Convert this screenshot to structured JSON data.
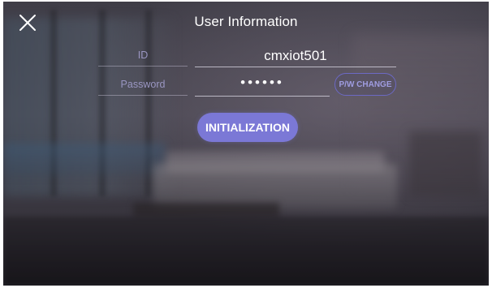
{
  "header": {
    "title": "User Information",
    "close_icon": "close-icon"
  },
  "form": {
    "id_label": "ID",
    "id_value": "cmxiot501",
    "password_label": "Password",
    "password_value": "••••••",
    "pw_change_label": "P/W CHANGE"
  },
  "actions": {
    "initialization_label": "INITIALIZATION"
  },
  "colors": {
    "accent": "#7b78d6",
    "label": "#9a96c2",
    "outline_button": "#6c69c4",
    "text": "#ffffff"
  }
}
